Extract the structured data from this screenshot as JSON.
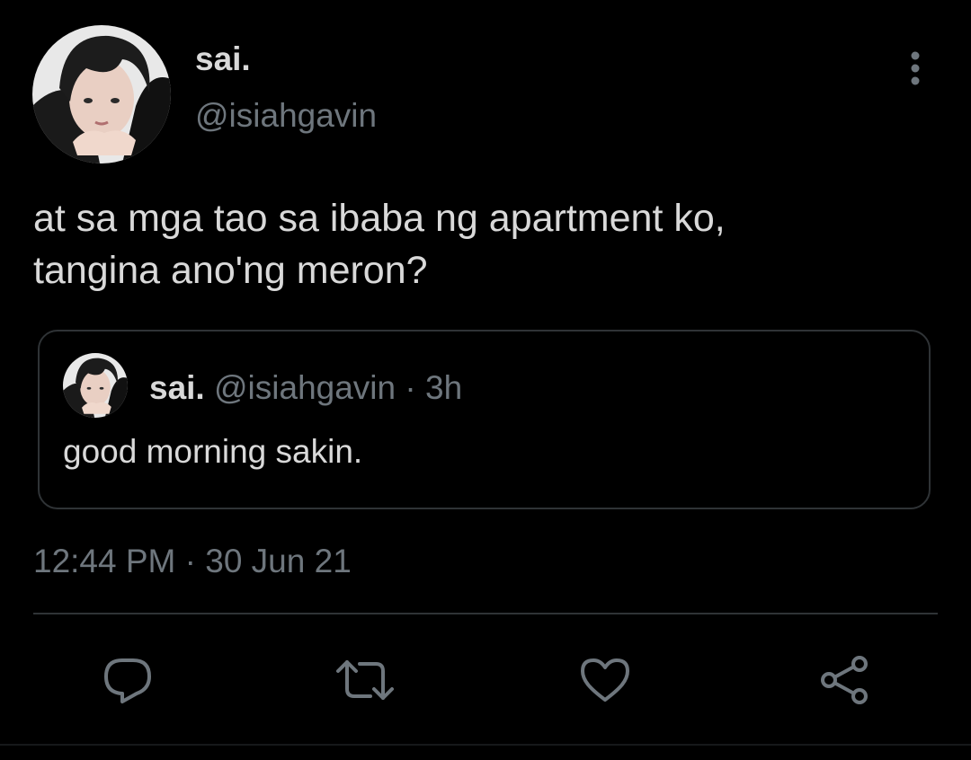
{
  "author": {
    "display_name": "sai.",
    "handle": "@isiahgavin"
  },
  "tweet": {
    "text": "at sa mga tao sa ibaba ng apartment ko,\ntangina ano'ng meron?",
    "timestamp": "12:44 PM · 30 Jun 21"
  },
  "quoted_tweet": {
    "display_name": "sai.",
    "meta": "@isiahgavin · 3h",
    "text": "good morning sakin."
  },
  "icons": {
    "more": "more-vertical-icon",
    "reply": "reply-icon",
    "retweet": "retweet-icon",
    "like": "heart-icon",
    "share": "share-icon"
  },
  "colors": {
    "background": "#000000",
    "text": "#d9d9d9",
    "muted": "#6e767d",
    "border": "#2f3336"
  }
}
